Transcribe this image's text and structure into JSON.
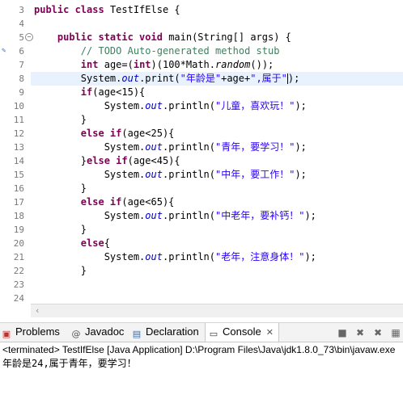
{
  "editor": {
    "line_numbers": [
      "3",
      "4",
      "5",
      "6",
      "7",
      "8",
      "9",
      "10",
      "11",
      "12",
      "13",
      "14",
      "15",
      "16",
      "17",
      "18",
      "19",
      "20",
      "21",
      "22",
      "23",
      "24"
    ],
    "lines": {
      "l3": [
        "public class",
        "TestIfElse {"
      ],
      "l5": [
        "public static void",
        "main(String[] args) {"
      ],
      "l6": "// TODO Auto-generated method stub",
      "l7": [
        "int",
        "age=(",
        "int",
        ")(100*Math.",
        "random",
        "());"
      ],
      "l8": [
        "System.",
        "out",
        ".print(",
        "\"年龄是\"",
        "+age+",
        "\",属于\"",
        ");"
      ],
      "l9": [
        "if",
        "(age<15){"
      ],
      "l10": [
        "System.",
        "out",
        ".println(",
        "\"儿童，喜欢玩！\"",
        ");"
      ],
      "l11": "}",
      "l12": [
        "else if",
        "(age<25){"
      ],
      "l13": [
        "System.",
        "out",
        ".println(",
        "\"青年，要学习！\"",
        ");"
      ],
      "l14": [
        "}",
        "else if",
        "(age<45){"
      ],
      "l15": [
        "System.",
        "out",
        ".println(",
        "\"中年，要工作！\"",
        ");"
      ],
      "l16": "}",
      "l17": [
        "else if",
        "(age<65){"
      ],
      "l18": [
        "System.",
        "out",
        ".println(",
        "\"中老年，要补钙！\"",
        ");"
      ],
      "l19": "}",
      "l20": [
        "else",
        "{"
      ],
      "l21": [
        "System.",
        "out",
        ".println(",
        "\"老年，注意身体！\"",
        ");"
      ],
      "l22": "}"
    }
  },
  "views": {
    "tabs": [
      {
        "label": "Problems",
        "icon": "problems-icon"
      },
      {
        "label": "Javadoc",
        "icon": "at-icon"
      },
      {
        "label": "Declaration",
        "icon": "declaration-icon"
      },
      {
        "label": "Console",
        "icon": "console-icon",
        "active": true
      }
    ],
    "close_glyph": "✕"
  },
  "console": {
    "status": "<terminated> TestIfElse [Java Application] D:\\Program Files\\Java\\jdk1.8.0_73\\bin\\javaw.exe",
    "output": "年龄是24,属于青年，要学习！"
  },
  "colors": {
    "keyword": "#7f0055",
    "comment": "#3f7f5f",
    "string": "#2a00ff",
    "field": "#0000c0",
    "current_line": "#e8f2fe"
  }
}
